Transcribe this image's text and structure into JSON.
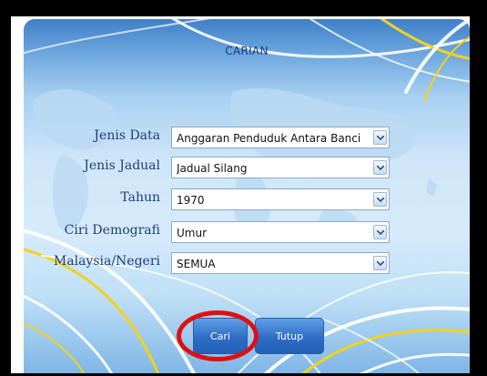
{
  "dialog": {
    "title": "CARIAN"
  },
  "fields": [
    {
      "label": "Jenis Data",
      "value": "Anggaran Penduduk Antara Banci"
    },
    {
      "label": "Jenis Jadual",
      "value": "Jadual Silang"
    },
    {
      "label": "Tahun",
      "value": "1970"
    },
    {
      "label": "Ciri Demografi",
      "value": "Umur"
    },
    {
      "label": "Malaysia/Negeri",
      "value": "SEMUA"
    }
  ],
  "buttons": {
    "search_label": "Cari",
    "close_label": "Tutup"
  },
  "colors": {
    "annotation_circle": "#e01010",
    "button_blue": "#2f6dc6",
    "label_text": "#1f3d7a"
  }
}
